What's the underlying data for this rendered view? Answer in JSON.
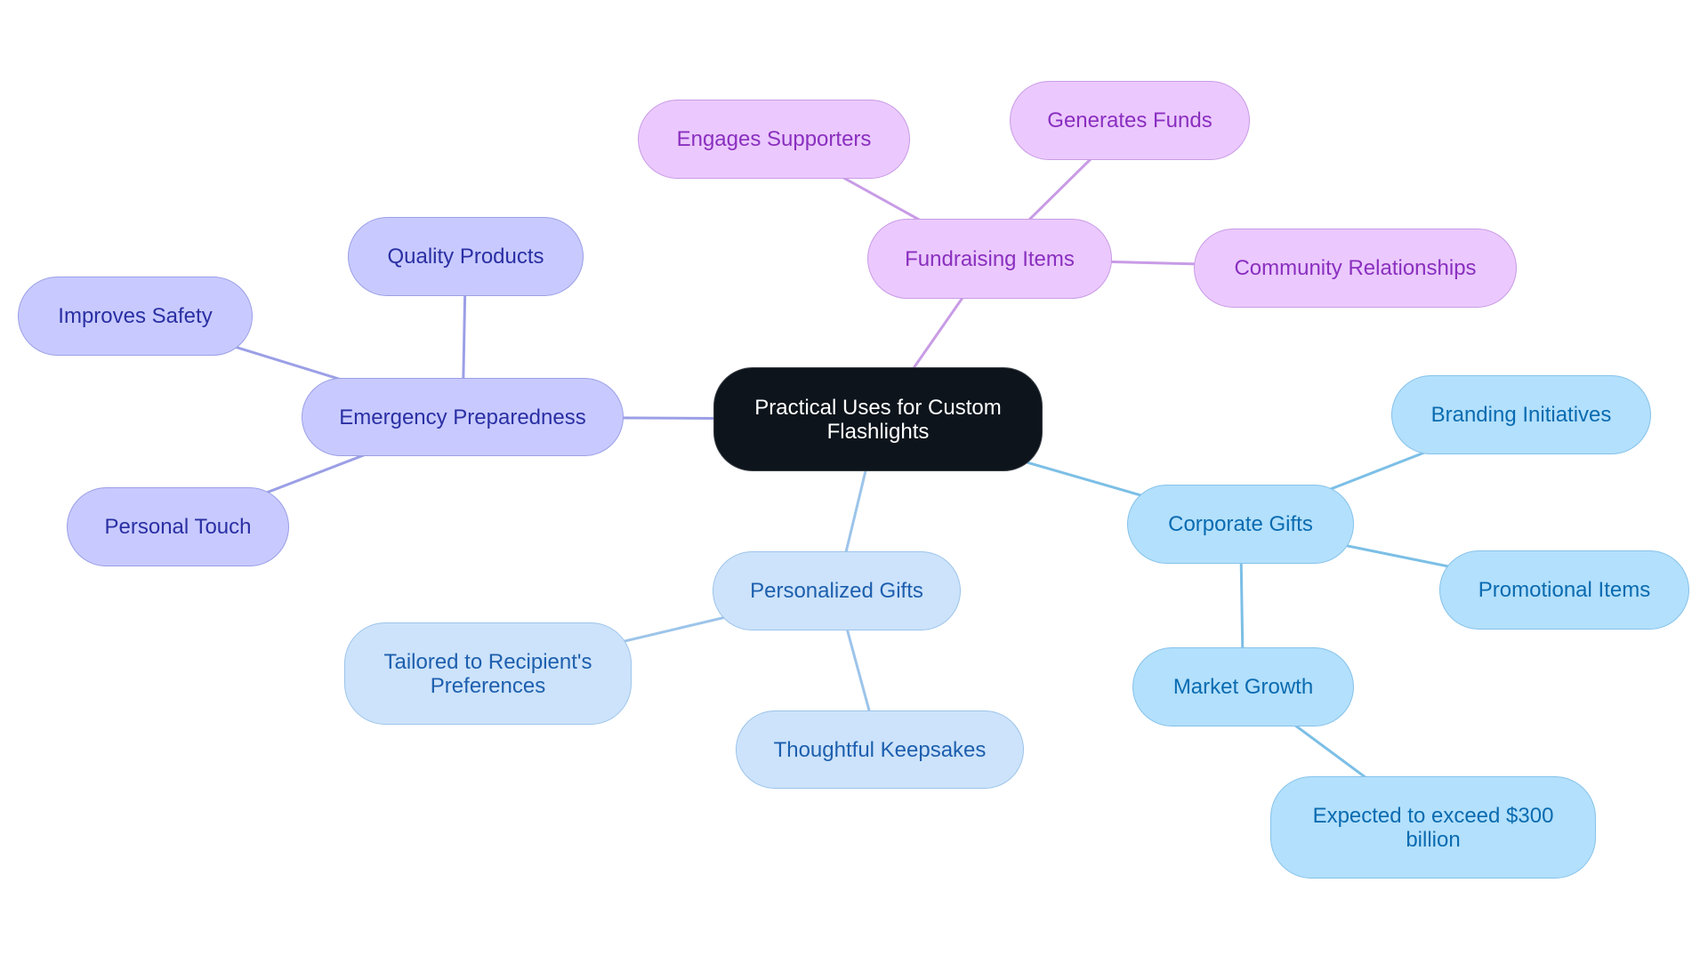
{
  "diagram": {
    "type": "mindmap",
    "root": {
      "id": "root",
      "label": "Practical Uses for Custom Flashlights"
    },
    "branches": [
      {
        "id": "fundraising",
        "label": "Fundraising Items",
        "theme": "purple",
        "children": [
          {
            "id": "engages",
            "label": "Engages Supporters"
          },
          {
            "id": "generates",
            "label": "Generates Funds"
          },
          {
            "id": "community",
            "label": "Community Relationships"
          }
        ]
      },
      {
        "id": "emergency",
        "label": "Emergency Preparedness",
        "theme": "indigo",
        "children": [
          {
            "id": "quality",
            "label": "Quality Products"
          },
          {
            "id": "safety",
            "label": "Improves Safety"
          },
          {
            "id": "personal",
            "label": "Personal Touch"
          }
        ]
      },
      {
        "id": "personalized",
        "label": "Personalized Gifts",
        "theme": "lblue",
        "children": [
          {
            "id": "tailored",
            "label": "Tailored to Recipient's Preferences"
          },
          {
            "id": "keepsakes",
            "label": "Thoughtful Keepsakes"
          }
        ]
      },
      {
        "id": "corporate",
        "label": "Corporate Gifts",
        "theme": "cyan",
        "children": [
          {
            "id": "branding",
            "label": "Branding Initiatives"
          },
          {
            "id": "promotional",
            "label": "Promotional Items"
          },
          {
            "id": "market",
            "label": "Market Growth",
            "children": [
              {
                "id": "expected",
                "label": "Expected to exceed $300 billion"
              }
            ]
          }
        ]
      }
    ],
    "colors": {
      "root_bg": "#0d141b",
      "purple": {
        "fill": "#ebc9fe",
        "stroke": "#c99be6",
        "text": "#8a2fbf",
        "edge": "#c89be6"
      },
      "indigo": {
        "fill": "#c8caff",
        "stroke": "#9b9fe6",
        "text": "#2a2fa3",
        "edge": "#9b9fe6"
      },
      "lblue": {
        "fill": "#cde3fb",
        "stroke": "#9cc4ea",
        "text": "#1d5fae",
        "edge": "#9cc4ea"
      },
      "cyan": {
        "fill": "#b3e0fc",
        "stroke": "#86c2ea",
        "text": "#0a6bb0",
        "edge": "#7cbfe6"
      }
    }
  }
}
